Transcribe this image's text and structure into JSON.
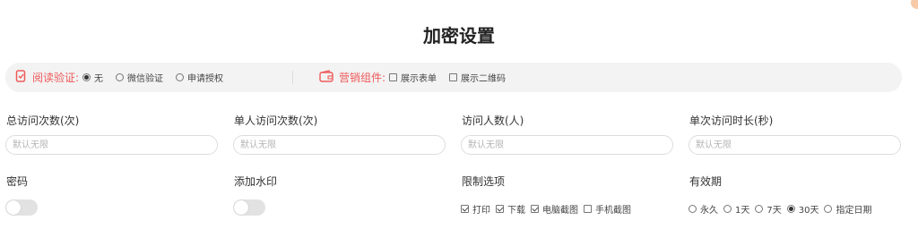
{
  "page_title": "加密设置",
  "colors": {
    "accent": "#ef5a5a",
    "bar_bg": "#f3f3f3",
    "toggle_off": "#e2e2e2"
  },
  "read_verify": {
    "icon": "phone-lock-icon",
    "label": "阅读验证:",
    "options": [
      {
        "label": "无",
        "selected": true
      },
      {
        "label": "微信验证",
        "selected": false
      },
      {
        "label": "申请授权",
        "selected": false
      }
    ]
  },
  "marketing": {
    "icon": "wallet-icon",
    "label": "营销组件:",
    "options": [
      {
        "label": "展示表单",
        "checked": false
      },
      {
        "label": "展示二维码",
        "checked": false
      }
    ]
  },
  "fields": [
    {
      "label": "总访问次数(次)",
      "placeholder": "默认无限"
    },
    {
      "label": "单人访问次数(次)",
      "placeholder": "默认无限"
    },
    {
      "label": "访问人数(人)",
      "placeholder": "默认无限"
    },
    {
      "label": "单次访问时长(秒)",
      "placeholder": "默认无限"
    }
  ],
  "password": {
    "label": "密码",
    "enabled": false
  },
  "watermark": {
    "label": "添加水印",
    "enabled": false
  },
  "restrictions": {
    "label": "限制选项",
    "options": [
      {
        "label": "打印",
        "checked": true
      },
      {
        "label": "下载",
        "checked": true
      },
      {
        "label": "电脑截图",
        "checked": true
      },
      {
        "label": "手机截图",
        "checked": false
      }
    ]
  },
  "validity": {
    "label": "有效期",
    "options": [
      {
        "label": "永久",
        "selected": false
      },
      {
        "label": "1天",
        "selected": false
      },
      {
        "label": "7天",
        "selected": false
      },
      {
        "label": "30天",
        "selected": true
      },
      {
        "label": "指定日期",
        "selected": false
      }
    ]
  }
}
